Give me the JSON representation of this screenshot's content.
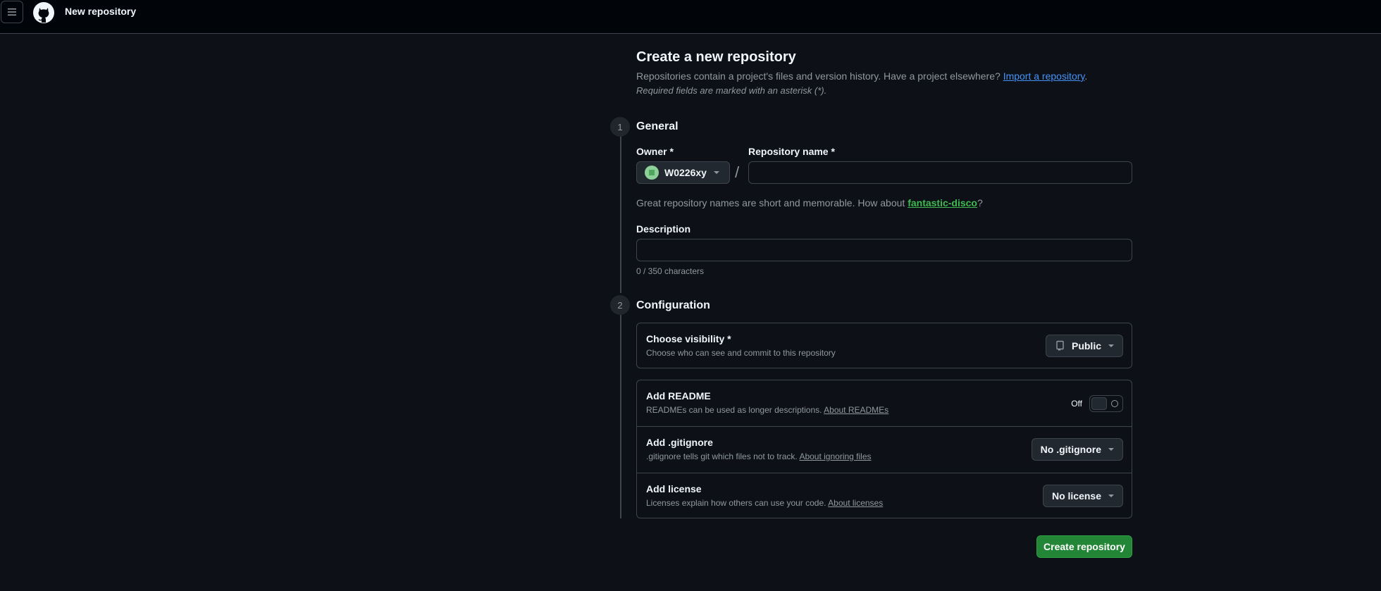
{
  "topbar": {
    "title": "New repository",
    "menu_icon": "hamburger-icon",
    "logo": "github-logo"
  },
  "header": {
    "title": "Create a new repository",
    "intro_text": "Repositories contain a project's files and version history. Have a project elsewhere? ",
    "import_link": "Import a repository",
    "intro_end": ".",
    "required_note": "Required fields are marked with an asterisk (*)."
  },
  "general": {
    "step": "1",
    "title": "General",
    "owner_label": "Owner *",
    "owner_value": "W0226xy",
    "slash": "/",
    "repo_label": "Repository name *",
    "repo_value": "",
    "hint_text": "Great repository names are short and memorable. How about ",
    "suggestion": "fantastic-disco",
    "hint_end": "?",
    "description_label": "Description",
    "description_value": "",
    "char_counter": "0 / 350 characters"
  },
  "configuration": {
    "step": "2",
    "title": "Configuration",
    "visibility": {
      "title": "Choose visibility *",
      "desc": "Choose who can see and commit to this repository",
      "value": "Public"
    },
    "readme": {
      "title": "Add README",
      "desc": "READMEs can be used as longer descriptions. ",
      "link": "About READMEs",
      "toggle_label": "Off"
    },
    "gitignore": {
      "title": "Add .gitignore",
      "desc": ".gitignore tells git which files not to track. ",
      "link": "About ignoring files",
      "value": "No .gitignore"
    },
    "license": {
      "title": "Add license",
      "desc": "Licenses explain how others can use your code. ",
      "link": "About licenses",
      "value": "No license"
    }
  },
  "actions": {
    "create_label": "Create repository"
  },
  "colors": {
    "background": "#0d1117",
    "topbar": "#010409",
    "accent_link": "#4493f8",
    "success": "#238636",
    "border": "#3d444d"
  }
}
